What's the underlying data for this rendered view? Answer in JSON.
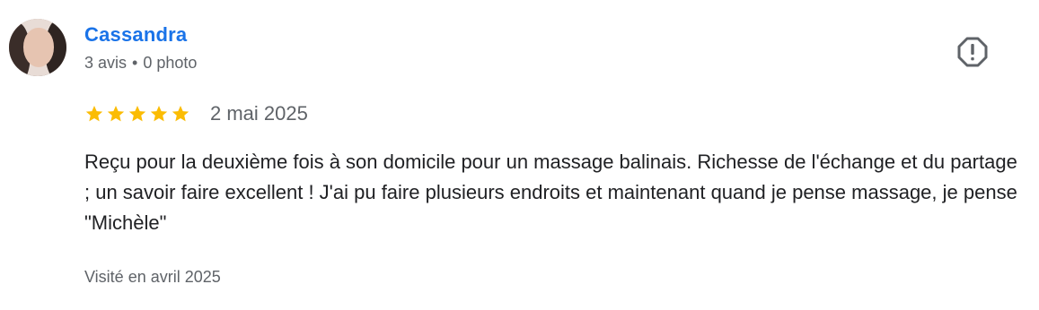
{
  "reviewer": {
    "name": "Cassandra",
    "stats_reviews": "3 avis",
    "stats_separator": "•",
    "stats_photos": "0 photo",
    "avatar_icon": "user-avatar-photo"
  },
  "review": {
    "rating": 5,
    "rating_max": 5,
    "date": "2 mai 2025",
    "text": "Reçu pour la deuxième fois à son domicile pour un massage balinais. Richesse de l'échange et du partage ; un savoir faire excellent ! J'ai pu faire plusieurs endroits et maintenant quand je pense massage, je pense \"Michèle\"",
    "visited": "Visité en avril 2025"
  },
  "actions": {
    "report_icon": "report-icon"
  },
  "colors": {
    "name": "#1a73e8",
    "star": "#fbbc04",
    "meta": "#5f6368",
    "text": "#202124",
    "icon": "#5f6368"
  }
}
